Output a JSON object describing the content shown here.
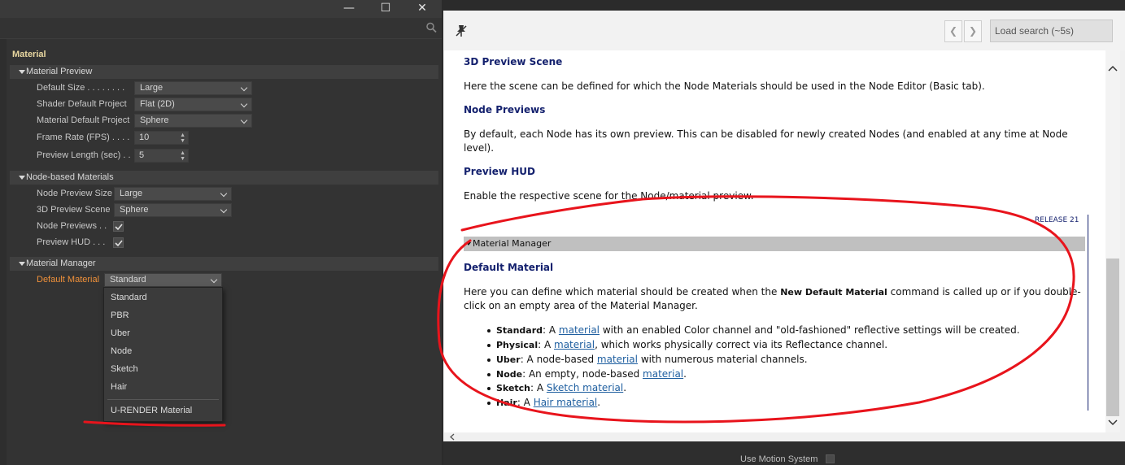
{
  "prefs": {
    "window": {
      "minimize": "—",
      "maximize": "☐",
      "close": "✕"
    },
    "section_title": "Material",
    "groups": {
      "material_preview": "Material Preview",
      "node_based": "Node-based Materials",
      "material_manager": "Material Manager"
    },
    "fields": {
      "default_size": {
        "label": "Default Size . . . . . . . .",
        "value": "Large"
      },
      "shader_default_project": {
        "label": "Shader Default Project",
        "value": "Flat (2D)"
      },
      "material_default_project": {
        "label": "Material Default Project",
        "value": "Sphere"
      },
      "frame_rate": {
        "label": "Frame Rate (FPS)  . . . .",
        "value": "10"
      },
      "preview_length": {
        "label": "Preview Length (sec) . .",
        "value": "5"
      },
      "node_preview_size": {
        "label": "Node Preview Size",
        "value": "Large"
      },
      "preview_scene_3d": {
        "label": "3D Preview Scene",
        "value": "Sphere"
      },
      "node_previews": {
        "label": "Node Previews . ."
      },
      "preview_hud": {
        "label": "Preview HUD . . ."
      },
      "default_material": {
        "label": "Default Material",
        "value": "Standard"
      }
    },
    "menu_options": [
      "Standard",
      "PBR",
      "Uber",
      "Node",
      "Sketch",
      "Hair",
      "U-RENDER Material"
    ]
  },
  "help": {
    "load_search": "Load search (~5s)",
    "nav_back": "❮",
    "nav_forward": "❯",
    "h_preview_scene": "3D Preview Scene",
    "p_preview_scene": "Here the scene can be defined for which the Node Materials should be used in the Node Editor (Basic tab).",
    "h_node_previews": "Node Previews",
    "p_node_previews_1": "By default, each Node has its own preview. This can be disabled for newly created Nodes (and enabled at any time at Node",
    "p_node_previews_2": "level).",
    "h_preview_hud": "Preview HUD",
    "p_preview_hud": "Enable the respective scene for the Node/material preview.",
    "release": "RELEASE 21",
    "mm_bar": "Material Manager",
    "h_default_material": "Default Material",
    "p_default_1a": "Here you can define which material should be created when the ",
    "p_default_1b": "New Default Material",
    "p_default_1c": " command is called up or if you double-",
    "p_default_2": "click on an empty area of the Material Manager.",
    "bullets": [
      {
        "term": "Standard",
        "pre": ": A ",
        "link": "material",
        "post": " with an enabled Color channel and \"old-fashioned\" reflective settings will be created."
      },
      {
        "term": "Physical",
        "pre": ": A ",
        "link": "material",
        "post": ", which works physically correct via its Reflectance channel."
      },
      {
        "term": "Uber",
        "pre": ": A node-based ",
        "link": "material",
        "post": " with numerous material channels."
      },
      {
        "term": "Node",
        "pre": ": An empty, node-based ",
        "link": "material",
        "post": "."
      },
      {
        "term": "Sketch",
        "pre": ": A ",
        "link": "Sketch material",
        "post": "."
      },
      {
        "term": "Hair",
        "pre": ": A ",
        "link": "Hair material",
        "post": "."
      }
    ]
  },
  "background": {
    "bottom_label": "Use Motion System"
  },
  "colors": {
    "annotation": "#e8141c",
    "active_label": "#f0913a",
    "help_heading": "#14216e",
    "link": "#1f5fa0"
  }
}
